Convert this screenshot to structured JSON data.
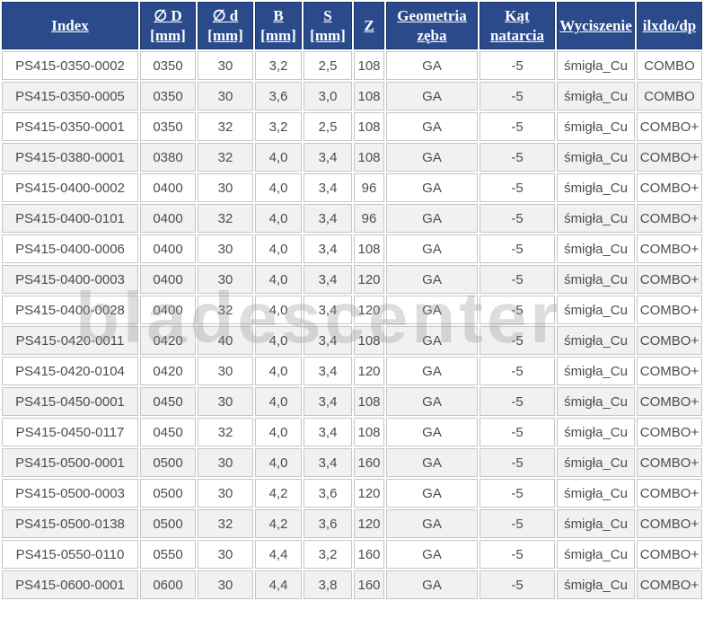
{
  "watermark": {
    "text": "bladescenter",
    "color": "#cccccc"
  },
  "table": {
    "header_bg": "#2b4a8c",
    "header_text_color": "#ffffff",
    "row_bg": "#ffffff",
    "row_alt_bg": "#f1f1f1",
    "border_color": "#c6c6c6",
    "text_color": "#4d4d4d",
    "columns": [
      {
        "id": "index",
        "label": "Index",
        "lines": [
          "Index"
        ]
      },
      {
        "id": "diameter-D-mm",
        "label": "∅ D [mm]",
        "lines": [
          "∅ D",
          "[mm]"
        ]
      },
      {
        "id": "diameter-d-mm",
        "label": "∅ d [mm]",
        "lines": [
          "∅ d",
          "[mm]"
        ]
      },
      {
        "id": "B-mm",
        "label": "B [mm]",
        "lines": [
          "B",
          "[mm]"
        ]
      },
      {
        "id": "S-mm",
        "label": "S [mm]",
        "lines": [
          "S",
          "[mm]"
        ]
      },
      {
        "id": "Z",
        "label": "Z",
        "lines": [
          "Z"
        ]
      },
      {
        "id": "geometria-zeba",
        "label": "Geometria zęba",
        "lines": [
          "Geometria",
          "zęba"
        ]
      },
      {
        "id": "kat-natarcia",
        "label": "Kąt natarcia",
        "lines": [
          "Kąt",
          "natarcia"
        ]
      },
      {
        "id": "wyciszenie",
        "label": "Wyciszenie",
        "lines": [
          "Wyciszenie"
        ]
      },
      {
        "id": "ilxdo-dp",
        "label": "ilxdo/dp",
        "lines": [
          "ilxdo/dp"
        ]
      }
    ],
    "rows": [
      [
        "PS415-0350-0002",
        "0350",
        "30",
        "3,2",
        "2,5",
        "108",
        "GA",
        "-5",
        "śmigła_Cu",
        "COMBO"
      ],
      [
        "PS415-0350-0005",
        "0350",
        "30",
        "3,6",
        "3,0",
        "108",
        "GA",
        "-5",
        "śmigła_Cu",
        "COMBO"
      ],
      [
        "PS415-0350-0001",
        "0350",
        "32",
        "3,2",
        "2,5",
        "108",
        "GA",
        "-5",
        "śmigła_Cu",
        "COMBO+"
      ],
      [
        "PS415-0380-0001",
        "0380",
        "32",
        "4,0",
        "3,4",
        "108",
        "GA",
        "-5",
        "śmigła_Cu",
        "COMBO+"
      ],
      [
        "PS415-0400-0002",
        "0400",
        "30",
        "4,0",
        "3,4",
        "96",
        "GA",
        "-5",
        "śmigła_Cu",
        "COMBO+"
      ],
      [
        "PS415-0400-0101",
        "0400",
        "32",
        "4,0",
        "3,4",
        "96",
        "GA",
        "-5",
        "śmigła_Cu",
        "COMBO+"
      ],
      [
        "PS415-0400-0006",
        "0400",
        "30",
        "4,0",
        "3,4",
        "108",
        "GA",
        "-5",
        "śmigła_Cu",
        "COMBO+"
      ],
      [
        "PS415-0400-0003",
        "0400",
        "30",
        "4,0",
        "3,4",
        "120",
        "GA",
        "-5",
        "śmigła_Cu",
        "COMBO+"
      ],
      [
        "PS415-0400-0028",
        "0400",
        "32",
        "4,0",
        "3,4",
        "120",
        "GA",
        "-5",
        "śmigła_Cu",
        "COMBO+"
      ],
      [
        "PS415-0420-0011",
        "0420",
        "40",
        "4,0",
        "3,4",
        "108",
        "GA",
        "-5",
        "śmigła_Cu",
        "COMBO+"
      ],
      [
        "PS415-0420-0104",
        "0420",
        "30",
        "4,0",
        "3,4",
        "120",
        "GA",
        "-5",
        "śmigła_Cu",
        "COMBO+"
      ],
      [
        "PS415-0450-0001",
        "0450",
        "30",
        "4,0",
        "3,4",
        "108",
        "GA",
        "-5",
        "śmigła_Cu",
        "COMBO+"
      ],
      [
        "PS415-0450-0117",
        "0450",
        "32",
        "4,0",
        "3,4",
        "108",
        "GA",
        "-5",
        "śmigła_Cu",
        "COMBO+"
      ],
      [
        "PS415-0500-0001",
        "0500",
        "30",
        "4,0",
        "3,4",
        "160",
        "GA",
        "-5",
        "śmigła_Cu",
        "COMBO+"
      ],
      [
        "PS415-0500-0003",
        "0500",
        "30",
        "4,2",
        "3,6",
        "120",
        "GA",
        "-5",
        "śmigła_Cu",
        "COMBO+"
      ],
      [
        "PS415-0500-0138",
        "0500",
        "32",
        "4,2",
        "3,6",
        "120",
        "GA",
        "-5",
        "śmigła_Cu",
        "COMBO+"
      ],
      [
        "PS415-0550-0110",
        "0550",
        "30",
        "4,4",
        "3,2",
        "160",
        "GA",
        "-5",
        "śmigła_Cu",
        "COMBO+"
      ],
      [
        "PS415-0600-0001",
        "0600",
        "30",
        "4,4",
        "3,8",
        "160",
        "GA",
        "-5",
        "śmigła_Cu",
        "COMBO+"
      ]
    ]
  }
}
